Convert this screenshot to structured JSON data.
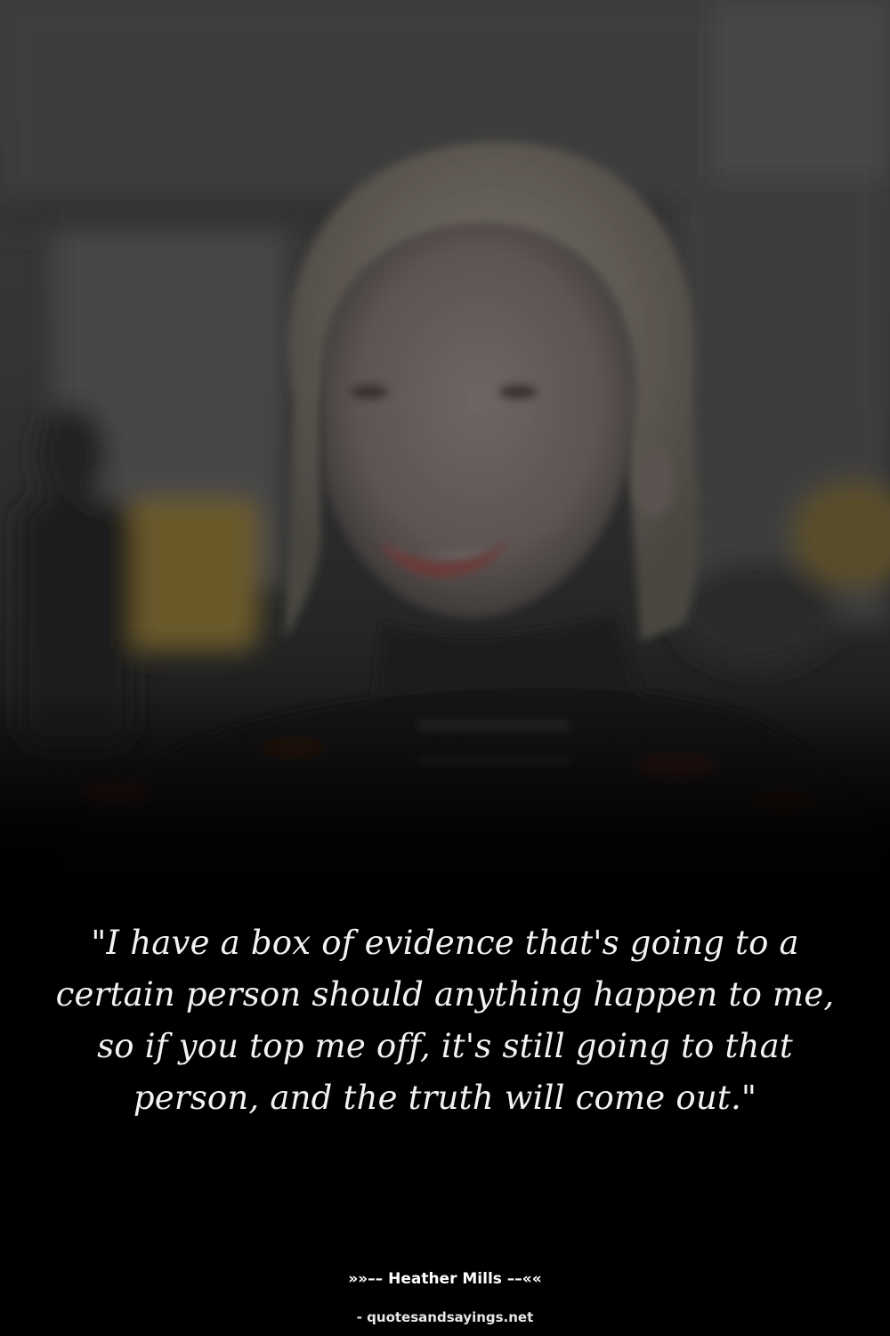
{
  "quote": {
    "text": "\"I have a box of evidence that's going to a certain person should anything happen to me, so if you top me off, it's still going to that person, and the truth will come out.\""
  },
  "author": {
    "line": "»»–– Heather Mills ––««"
  },
  "source": {
    "line": "- quotesandsayings.net"
  },
  "colors": {
    "background": "#000000",
    "text": "#f2f2f2"
  }
}
